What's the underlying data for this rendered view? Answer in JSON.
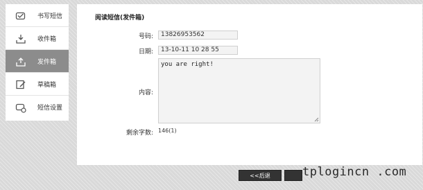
{
  "sidebar": {
    "items": [
      {
        "label": "书写短信",
        "icon": "write-message-icon",
        "active": false
      },
      {
        "label": "收件箱",
        "icon": "inbox-icon",
        "active": false
      },
      {
        "label": "发件箱",
        "icon": "outbox-icon",
        "active": true
      },
      {
        "label": "草稿箱",
        "icon": "drafts-icon",
        "active": false
      },
      {
        "label": "短信设置",
        "icon": "sms-settings-icon",
        "active": false
      }
    ]
  },
  "main": {
    "title": "阅读短信(发件箱)",
    "fields": {
      "number_label": "号码:",
      "number_value": "13826953562",
      "date_label": "日期:",
      "date_value": "13-10-11 10 28 55",
      "content_label": "内容:",
      "content_value": "you are right!",
      "remaining_label": "剩余字数:",
      "remaining_value": "146(1)"
    }
  },
  "footer": {
    "back_label": "<<后退"
  },
  "watermark": "tplogincn .com",
  "colors": {
    "active_nav": "#8c8c8c",
    "button": "#333333",
    "field_bg": "#f3f3f3"
  }
}
